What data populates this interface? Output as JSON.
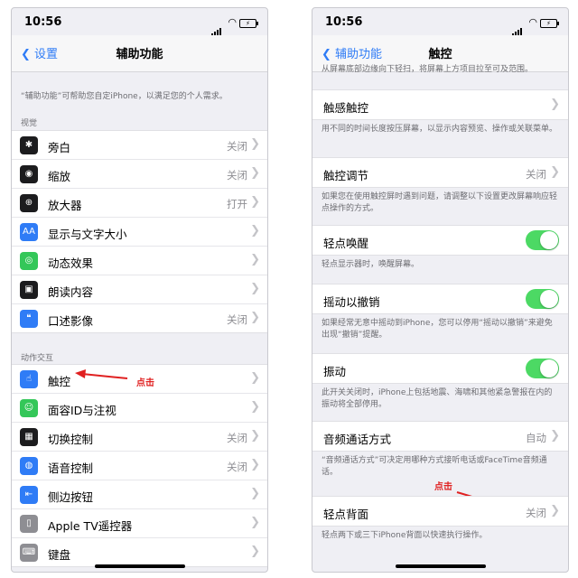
{
  "left": {
    "status_time": "10:56",
    "back_label": "设置",
    "title": "辅助功能",
    "intro": "“辅助功能”可帮助您自定iPhone，以满足您的个人需求。",
    "vision_header": "视觉",
    "vision_items": [
      {
        "label": "旁白",
        "value": "关闭",
        "icon": "voiceover-icon",
        "glyph": "✱",
        "color": "#1c1c1e"
      },
      {
        "label": "缩放",
        "value": "关闭",
        "icon": "zoom-icon",
        "glyph": "◉",
        "color": "#1c1c1e"
      },
      {
        "label": "放大器",
        "value": "打开",
        "icon": "magnifier-icon",
        "glyph": "⊕",
        "color": "#1c1c1e"
      },
      {
        "label": "显示与文字大小",
        "value": "",
        "icon": "text-size-icon",
        "glyph": "AA",
        "color": "#2f7cf6"
      },
      {
        "label": "动态效果",
        "value": "",
        "icon": "motion-icon",
        "glyph": "◎",
        "color": "#34c759"
      },
      {
        "label": "朗读内容",
        "value": "",
        "icon": "spoken-content-icon",
        "glyph": "▣",
        "color": "#1c1c1e"
      },
      {
        "label": "口述影像",
        "value": "关闭",
        "icon": "audio-description-icon",
        "glyph": "❝",
        "color": "#2f7cf6"
      }
    ],
    "motor_header": "动作交互",
    "motor_items": [
      {
        "label": "触控",
        "value": "",
        "icon": "touch-icon",
        "glyph": "☝",
        "color": "#2f7cf6"
      },
      {
        "label": "面容ID与注视",
        "value": "",
        "icon": "face-id-icon",
        "glyph": "☺",
        "color": "#34c759"
      },
      {
        "label": "切换控制",
        "value": "关闭",
        "icon": "switch-control-icon",
        "glyph": "▦",
        "color": "#1c1c1e"
      },
      {
        "label": "语音控制",
        "value": "关闭",
        "icon": "voice-control-icon",
        "glyph": "◍",
        "color": "#2f7cf6"
      },
      {
        "label": "侧边按钮",
        "value": "",
        "icon": "side-button-icon",
        "glyph": "⇤",
        "color": "#2f7cf6"
      },
      {
        "label": "Apple TV遥控器",
        "value": "",
        "icon": "tv-remote-icon",
        "glyph": "▯",
        "color": "#8e8e93"
      },
      {
        "label": "键盘",
        "value": "",
        "icon": "keyboard-icon",
        "glyph": "⌨",
        "color": "#8e8e93"
      }
    ],
    "annotation": "点击"
  },
  "right": {
    "status_time": "10:56",
    "back_label": "辅助功能",
    "title": "触控",
    "top_note": "从屏幕底部边缘向下轻扫，将屏幕上方项目拉至可及范围。",
    "haptic_touch": {
      "label": "触感触控",
      "note": "用不同的时间长度按压屏幕，以显示内容预览、操作或关联菜单。"
    },
    "touch_accommodations": {
      "label": "触控调节",
      "value": "关闭",
      "note": "如果您在使用触控屏时遇到问题，请调整以下设置更改屏幕响应轻点操作的方式。"
    },
    "tap_to_wake": {
      "label": "轻点唤醒",
      "note": "轻点显示器时，唤醒屏幕。",
      "on": true
    },
    "shake_to_undo": {
      "label": "摇动以撤销",
      "note": "如果经常无意中摇动到iPhone，您可以停用“摇动以撤销”来避免出现“撤销”提醒。",
      "on": true
    },
    "vibration": {
      "label": "振动",
      "note": "此开关关闭时，iPhone上包括地震、海啸和其他紧急警报在内的振动将全部停用。",
      "on": true
    },
    "call_audio": {
      "label": "音频通话方式",
      "value": "自动",
      "note": "“音频通话方式”可决定用哪种方式接听电话或FaceTime音频通话。"
    },
    "back_tap": {
      "label": "轻点背面",
      "value": "关闭",
      "note": "轻点两下或三下iPhone背面以快速执行操作。"
    },
    "annotation": "点击"
  },
  "colors": {
    "accent": "#2f7cf6",
    "toggle_on": "#4cd964",
    "annotation": "#e02020"
  }
}
